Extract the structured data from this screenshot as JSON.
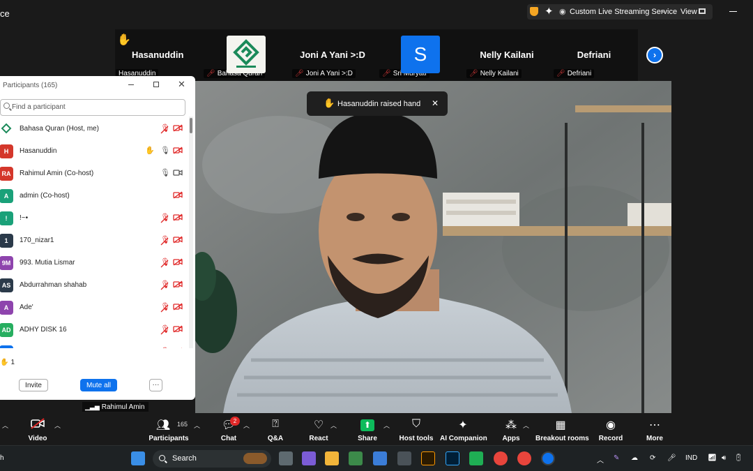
{
  "app": {
    "title_fragment": "ce"
  },
  "topbar": {
    "stream_label": "Custom Live Streaming Service",
    "view_label": "View"
  },
  "thumbnails": [
    {
      "display_name": "Hasanuddin",
      "label": "Hasanuddin",
      "muted": false,
      "hand_raised": true
    },
    {
      "display_name": "",
      "label": "Bahasa Quran",
      "muted": true,
      "logo": true
    },
    {
      "display_name": "Joni A Yani >:D",
      "label": "Joni A Yani >:D",
      "muted": true
    },
    {
      "display_name": "S",
      "label": "Sri Muryati",
      "muted": true,
      "avatar_color": "#0e72ed"
    },
    {
      "display_name": "Nelly Kailani",
      "label": "Nelly Kailani",
      "muted": true
    },
    {
      "display_name": "Defriani",
      "label": "Defriani",
      "muted": true
    }
  ],
  "toast": {
    "text": "Hasanuddin raised hand"
  },
  "main_video": {
    "speaker_label": "Rahimul Amin"
  },
  "participants_panel": {
    "title": "Participants (165)",
    "search_placeholder": "Find a participant",
    "participants": [
      {
        "initials": "",
        "avatar_color": "#ffffff",
        "logo": true,
        "name": "Bahasa Quran (Host, me)",
        "hand": false,
        "mic": "off",
        "video": "off"
      },
      {
        "initials": "H",
        "avatar_color": "#d4372b",
        "name": "Hasanuddin",
        "hand": true,
        "mic": "on",
        "video": "off"
      },
      {
        "initials": "RA",
        "avatar_color": "#d4372b",
        "name": "Rahimul Amin (Co-host)",
        "hand": false,
        "mic": "on",
        "video": "on"
      },
      {
        "initials": "A",
        "avatar_color": "#1aa179",
        "name": "admin (Co-host)",
        "hand": false,
        "mic": "none",
        "video": "off"
      },
      {
        "initials": "!",
        "avatar_color": "#1aa179",
        "name": "!~•",
        "hand": false,
        "mic": "off",
        "video": "off"
      },
      {
        "initials": "1",
        "avatar_color": "#2b3a4a",
        "name": "170_nizar1",
        "hand": false,
        "mic": "off",
        "video": "off"
      },
      {
        "initials": "9M",
        "avatar_color": "#8e44ad",
        "name": "993. Mutia Lismar",
        "hand": false,
        "mic": "off",
        "video": "off"
      },
      {
        "initials": "AS",
        "avatar_color": "#2b3a4a",
        "name": "Abdurrahman shahab",
        "hand": false,
        "mic": "off",
        "video": "off"
      },
      {
        "initials": "A",
        "avatar_color": "#8e44ad",
        "name": "Ade'",
        "hand": false,
        "mic": "off",
        "video": "off"
      },
      {
        "initials": "AD",
        "avatar_color": "#27ae60",
        "name": "ADHY DISK 16",
        "hand": false,
        "mic": "off",
        "video": "off"
      },
      {
        "initials": "",
        "avatar_color": "#0e72ed",
        "name": "",
        "hand": false,
        "mic": "off",
        "video": "off"
      }
    ],
    "raised_hands_count": "1",
    "invite_label": "Invite",
    "mute_all_label": "Mute all",
    "more_label": "···"
  },
  "toolbar": {
    "video_label": "Video",
    "participants_label": "Participants",
    "participants_count": "165",
    "chat_label": "Chat",
    "chat_badge": "2",
    "qa_label": "Q&A",
    "react_label": "React",
    "share_label": "Share",
    "host_tools_label": "Host tools",
    "ai_label": "AI Companion",
    "apps_label": "Apps",
    "breakout_label": "Breakout rooms",
    "record_label": "Record",
    "more_label": "More"
  },
  "taskbar": {
    "search_label": "Search",
    "language": "IND",
    "left_fragment": "h"
  },
  "colors": {
    "accent_blue": "#0e72ed",
    "muted_red": "#e02828",
    "hand_yellow": "#f6c000",
    "share_green": "#0dbb5b"
  }
}
